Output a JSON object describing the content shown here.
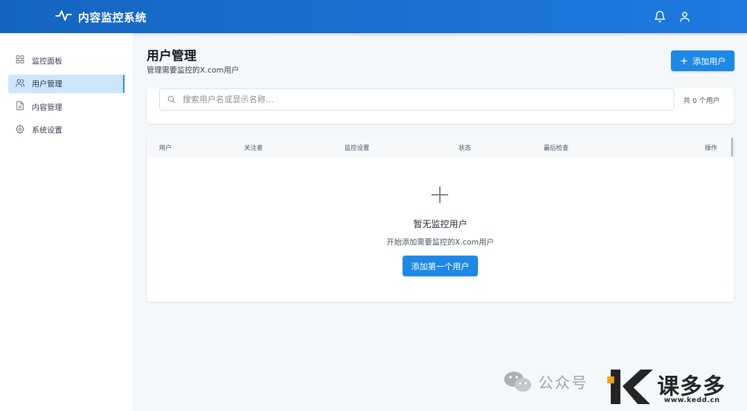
{
  "header": {
    "title": "内容监控系统",
    "logo_icon": "activity-pulse-icon",
    "icons": [
      "bell-icon",
      "user-icon"
    ]
  },
  "sidebar": {
    "items": [
      {
        "label": "监控面板",
        "icon": "grid-icon",
        "active": false
      },
      {
        "label": "用户管理",
        "icon": "users-icon",
        "active": true
      },
      {
        "label": "内容管理",
        "icon": "document-icon",
        "active": false
      },
      {
        "label": "系统设置",
        "icon": "gear-icon",
        "active": false
      }
    ]
  },
  "main": {
    "title": "用户管理",
    "subtitle": "管理需要监控的X.com用户",
    "add_button": "添加用户",
    "search": {
      "placeholder": "搜索用户名或显示名称...",
      "value": ""
    },
    "count_text": "共 0 个用户",
    "table": {
      "columns": [
        "用户",
        "关注者",
        "监控设置",
        "状态",
        "最后检查",
        "操作"
      ],
      "rows": []
    },
    "empty": {
      "title": "暂无监控用户",
      "description": "开始添加需要监控的X.com用户",
      "button": "添加第一个用户"
    }
  },
  "watermark": {
    "text": "公众号",
    "brand": "课多多",
    "url": "www.kedd.cn"
  },
  "colors": {
    "header": "#1e7ae0",
    "accent": "#1e88e5",
    "active_nav_bg": "#cde6fb",
    "background": "#f5f8fb"
  }
}
